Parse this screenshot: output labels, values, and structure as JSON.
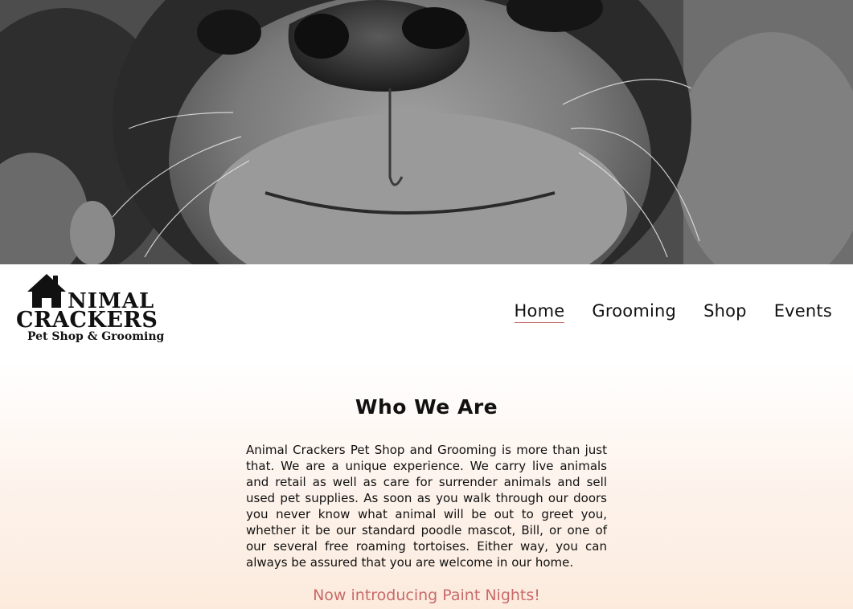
{
  "hero": {
    "image": "black-and-white dog nose close-up"
  },
  "logo": {
    "line1": "ANIMAL",
    "line2": "CRACKERS",
    "line3": "Pet Shop & Grooming"
  },
  "nav": {
    "items": [
      {
        "label": "Home",
        "active": true
      },
      {
        "label": "Grooming",
        "active": false
      },
      {
        "label": "Shop",
        "active": false
      },
      {
        "label": "Events",
        "active": false
      }
    ]
  },
  "main": {
    "title": "Who We Are",
    "about": "Animal Crackers Pet Shop and Grooming is more than just that. We are a unique experience. We carry live animals and retail as well as care for surrender animals and sell used pet supplies. As soon as you walk through our doors you never know what animal will be out to greet you, whether it be our standard poodle mascot, Bill, or one of our several free roaming tortoises. Either way, you can always be assured that you are welcome in our home.",
    "announcement": "Now introducing Paint Nights!"
  },
  "colors": {
    "accent": "#c96a6a",
    "text": "#111111"
  }
}
